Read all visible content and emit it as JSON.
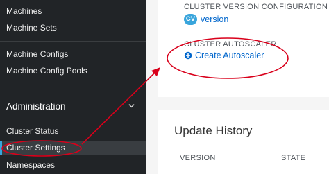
{
  "sidebar": {
    "items": [
      {
        "label": "Machines"
      },
      {
        "label": "Machine Sets"
      },
      {
        "label": "Machine Configs"
      },
      {
        "label": "Machine Config Pools"
      }
    ],
    "section": {
      "label": "Administration",
      "icon": "chevron-down-icon",
      "items": [
        {
          "label": "Cluster Status"
        },
        {
          "label": "Cluster Settings",
          "active": true
        },
        {
          "label": "Namespaces"
        }
      ]
    },
    "colors": {
      "background": "#212427",
      "active_background": "#393d41",
      "active_accent": "#39a5dc"
    }
  },
  "main": {
    "cluster_version_config": {
      "label": "CLUSTER VERSION CONFIGURATION",
      "badge": "CV",
      "link": "version"
    },
    "cluster_autoscaler": {
      "label": "CLUSTER AUTOSCALER",
      "icon": "plus-circle-icon",
      "link": "Create Autoscaler"
    },
    "update_history": {
      "title": "Update History",
      "columns": [
        "VERSION",
        "STATE"
      ]
    }
  },
  "annotations": {
    "color": "#d9001b",
    "shapes": "ellipse-and-arrow"
  }
}
